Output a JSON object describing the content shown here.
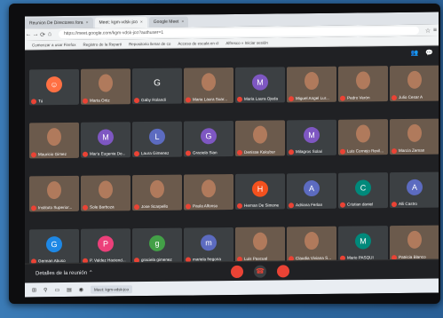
{
  "browser": {
    "tabs": [
      {
        "label": "Reunion De Directores fora",
        "active": false
      },
      {
        "label": "Meet: kgm-vdsk-jco",
        "active": true
      },
      {
        "label": "Google Meet",
        "active": false
      }
    ],
    "url": "https://meet.google.com/kgm-vdsk-jco?authuser=1",
    "bookmarks": [
      "Comenzar a usar Firefox",
      "Registro de la Reparti",
      "Repositorio llenar de co",
      "Acceso de escala en cl",
      "Alfresco » Iniciar sesión"
    ]
  },
  "meet": {
    "participants": [
      {
        "name": "Tú",
        "type": "emoji",
        "letter": "☺",
        "color": "#ff7043",
        "row": 0,
        "col": 0
      },
      {
        "name": "Marta Ortiz",
        "type": "photo",
        "row": 0,
        "col": 1
      },
      {
        "name": "Gaby Rolandi",
        "type": "letter",
        "letter": "G",
        "color": "#3c4043",
        "row": 0,
        "col": 2
      },
      {
        "name": "Maria Laura Suar...",
        "type": "photo",
        "row": 0,
        "col": 3
      },
      {
        "name": "Maria Laura Ojeda",
        "type": "avatar",
        "letter": "M",
        "color": "#7e57c2",
        "row": 0,
        "col": 4
      },
      {
        "name": "Miguel Angel Lur...",
        "type": "photo",
        "row": 0,
        "col": 5
      },
      {
        "name": "Pedro Verón",
        "type": "photo",
        "row": 0,
        "col": 6
      },
      {
        "name": "Julio Cesar A",
        "type": "photo",
        "row": 0,
        "col": 7
      },
      {
        "name": "Mauricio Gimez",
        "type": "photo",
        "row": 1,
        "col": 0
      },
      {
        "name": "Mar'a Eugenia De...",
        "type": "avatar",
        "letter": "M",
        "color": "#7e57c2",
        "row": 1,
        "col": 1
      },
      {
        "name": "Laura Gimenez",
        "type": "avatar",
        "letter": "L",
        "color": "#5c6bc0",
        "row": 1,
        "col": 2
      },
      {
        "name": "Graciela Sian",
        "type": "avatar",
        "letter": "G",
        "color": "#7e57c2",
        "row": 1,
        "col": 3
      },
      {
        "name": "Denisse Kakubur",
        "type": "photo",
        "row": 1,
        "col": 4
      },
      {
        "name": "Milagros Solari",
        "type": "avatar",
        "letter": "M",
        "color": "#7e57c2",
        "row": 1,
        "col": 5
      },
      {
        "name": "Luis Cornejo Revil...",
        "type": "photo",
        "row": 1,
        "col": 6
      },
      {
        "name": "Marcia Zeman",
        "type": "photo",
        "row": 1,
        "col": 7
      },
      {
        "name": "Instituto Superior...",
        "type": "photo",
        "row": 2,
        "col": 0
      },
      {
        "name": "Sole Barboza",
        "type": "photo",
        "row": 2,
        "col": 1
      },
      {
        "name": "Jose Scarpello",
        "type": "photo",
        "row": 2,
        "col": 2
      },
      {
        "name": "Paula Alfonso",
        "type": "photo",
        "row": 2,
        "col": 3
      },
      {
        "name": "Hernan De Simone",
        "type": "avatar",
        "letter": "H",
        "color": "#f4511e",
        "row": 2,
        "col": 4
      },
      {
        "name": "Adriana Ferlan",
        "type": "avatar",
        "letter": "A",
        "color": "#5c6bc0",
        "row": 2,
        "col": 5
      },
      {
        "name": "Cristian daniel",
        "type": "avatar",
        "letter": "C",
        "color": "#00897b",
        "row": 2,
        "col": 6
      },
      {
        "name": "Alli Castro",
        "type": "avatar",
        "letter": "A",
        "color": "#5c6bc0",
        "row": 2,
        "col": 7
      },
      {
        "name": "German Abuso",
        "type": "avatar",
        "letter": "G",
        "color": "#1e88e5",
        "row": 3,
        "col": 0
      },
      {
        "name": "P. Valdez Haciend...",
        "type": "avatar",
        "letter": "P",
        "color": "#ec407a",
        "row": 3,
        "col": 1
      },
      {
        "name": "graciela gimenez",
        "type": "avatar",
        "letter": "g",
        "color": "#43a047",
        "row": 3,
        "col": 2
      },
      {
        "name": "mariela fregona",
        "type": "avatar",
        "letter": "m",
        "color": "#5c6bc0",
        "row": 3,
        "col": 3
      },
      {
        "name": "Luis Pascual",
        "type": "photo",
        "row": 3,
        "col": 4
      },
      {
        "name": "Claudia Viviana S...",
        "type": "photo",
        "row": 3,
        "col": 5
      },
      {
        "name": "Mario PASQUI",
        "type": "avatar",
        "letter": "M",
        "color": "#00897b",
        "row": 3,
        "col": 6
      },
      {
        "name": "Patricia Blanco",
        "type": "photo",
        "row": 3,
        "col": 7
      }
    ],
    "details_label": "Detalles de la reunión"
  },
  "taskbar": {
    "app_label": "Meet: kgm-vdsk-jco"
  },
  "colors": {
    "meet_bg": "#202124",
    "tile_bg": "#3c4043",
    "end_call": "#ea4335",
    "accent_red": "#ea4335"
  }
}
